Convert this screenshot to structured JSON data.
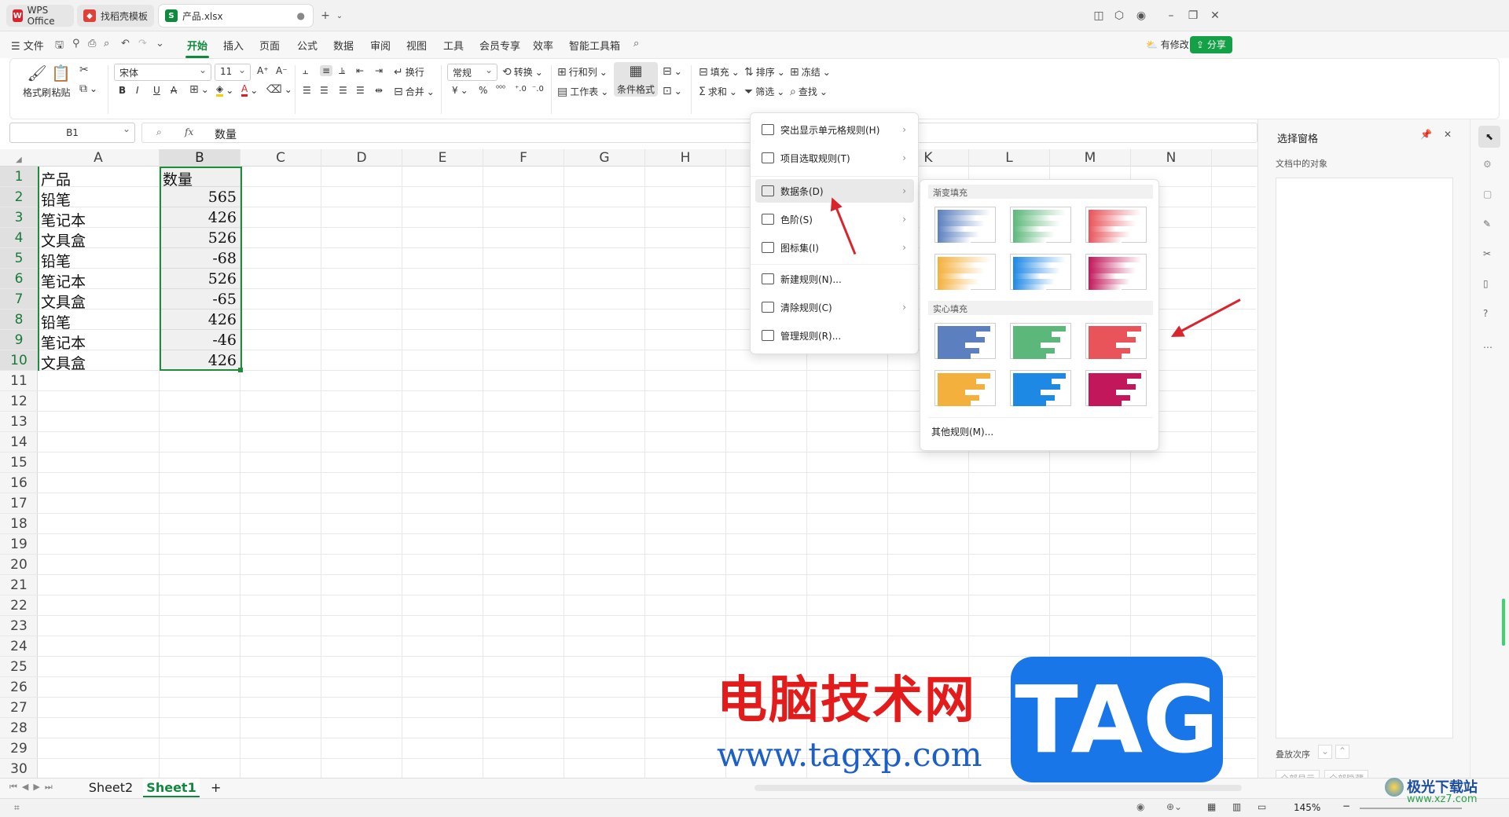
{
  "tabs": [
    {
      "label": "WPS Office",
      "icon": "wps-logo-icon"
    },
    {
      "label": "找稻壳模板",
      "icon": "docer-icon"
    },
    {
      "label": "产品.xlsx",
      "icon": "spreadsheet-icon"
    }
  ],
  "menubar": {
    "file": "文件",
    "items": [
      "开始",
      "插入",
      "页面",
      "公式",
      "数据",
      "审阅",
      "视图",
      "工具",
      "会员专享",
      "效率",
      "智能工具箱"
    ],
    "active": "开始",
    "has_changes": "有修改",
    "share": "分享"
  },
  "ribbon": {
    "format_painter": "格式刷",
    "paste": "粘贴",
    "font_name": "宋体",
    "font_size": "11",
    "wrap": "换行",
    "merge": "合并",
    "number_format": "常规",
    "convert": "转换",
    "row_col": "行和列",
    "worksheet": "工作表",
    "cond_format": "条件格式",
    "fill": "填充",
    "sort": "排序",
    "freeze": "冻结",
    "sum": "求和",
    "filter": "筛选",
    "find": "查找",
    "currency_symbol": "¥",
    "percent": "%"
  },
  "formula_bar": {
    "cell_ref": "B1",
    "fx": "fx",
    "value": "数量"
  },
  "columns": [
    "A",
    "B",
    "C",
    "D",
    "E",
    "F",
    "G",
    "H",
    "I",
    "J",
    "K",
    "L",
    "M",
    "N"
  ],
  "selected_column": "B",
  "rows": [
    "1",
    "2",
    "3",
    "4",
    "5",
    "6",
    "7",
    "8",
    "9",
    "10",
    "11",
    "12",
    "13",
    "14",
    "15",
    "16",
    "17",
    "18",
    "19",
    "20",
    "21",
    "22",
    "23",
    "24",
    "25",
    "26",
    "27",
    "28",
    "29",
    "30"
  ],
  "table": {
    "col_a": [
      "产品",
      "铅笔",
      "笔记本",
      "文具盒",
      "铅笔",
      "笔记本",
      "文具盒",
      "铅笔",
      "笔记本",
      "文具盒"
    ],
    "col_b": [
      "数量",
      "565",
      "426",
      "526",
      "-68",
      "526",
      "-65",
      "426",
      "-46",
      "426"
    ]
  },
  "cond_menu": {
    "items": [
      {
        "label": "突出显示单元格规则(H)",
        "submenu": true
      },
      {
        "label": "项目选取规则(T)",
        "submenu": true
      },
      {
        "label": "数据条(D)",
        "submenu": true
      },
      {
        "label": "色阶(S)",
        "submenu": true
      },
      {
        "label": "图标集(I)",
        "submenu": true
      },
      {
        "label": "新建规则(N)...",
        "submenu": false
      },
      {
        "label": "清除规则(C)",
        "submenu": true
      },
      {
        "label": "管理规则(R)...",
        "submenu": false
      }
    ]
  },
  "databar_menu": {
    "gradient_title": "渐变填充",
    "solid_title": "实心填充",
    "colors": [
      "#5b7fbf",
      "#5cb87a",
      "#e8545a",
      "#f4b03c",
      "#1e88e5",
      "#c2185b"
    ],
    "other_rules": "其他规则(M)..."
  },
  "side_pane": {
    "title": "选择窗格",
    "objects_label": "文档中的对象",
    "order_label": "叠放次序",
    "show_all": "全部显示",
    "hide_all": "全部隐藏"
  },
  "sheets": [
    "Sheet2",
    "Sheet1"
  ],
  "active_sheet": "Sheet1",
  "status": {
    "zoom": "145%"
  },
  "watermark": {
    "title": "电脑技术网",
    "url": "www.tagxp.com",
    "badge": "TAG",
    "corner": "极光下载站",
    "corner_url": "www.xz7.com"
  },
  "accent": "#0f8a3c"
}
